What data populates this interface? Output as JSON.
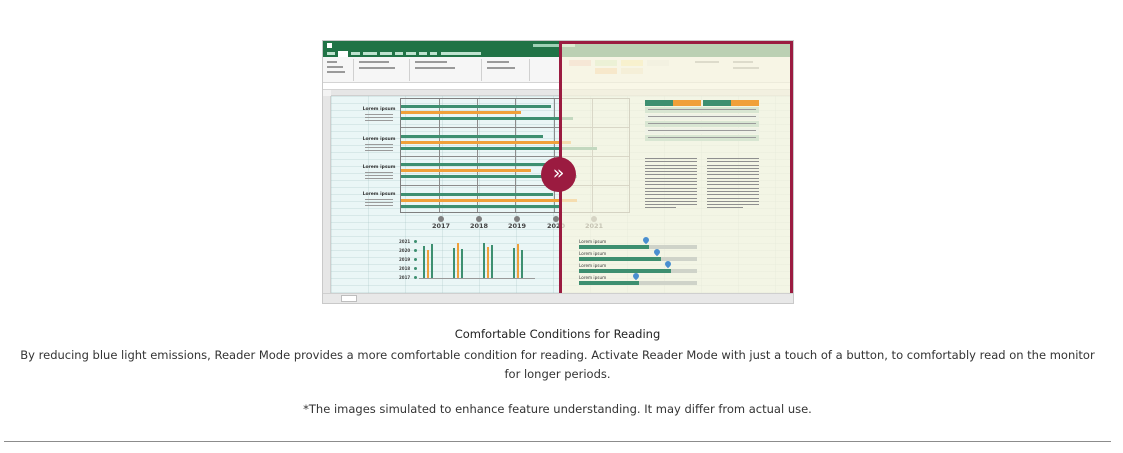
{
  "caption": {
    "title": "Comfortable Conditions for Reading",
    "description": "By reducing blue light emissions, Reader Mode provides a more comfortable condition for reading. Activate Reader Mode with just a touch of a button, to comfortably read on the monitor for longer periods.",
    "disclaimer": "*The images simulated to enhance feature understanding. It may differ from actual use."
  },
  "screenshot": {
    "year_labels": [
      "2017",
      "2018",
      "2019",
      "2020",
      "2021"
    ],
    "mini_years": [
      "2021",
      "2020",
      "2019",
      "2018",
      "2017"
    ],
    "label_block_heading": "Lorem ipsum",
    "progress_label": "Lorem ipsum",
    "toggle_icon": "double-chevron-right-icon",
    "toggle_glyph": "»",
    "colors": {
      "excel_green": "#217346",
      "bar_green": "#3d8f70",
      "bar_orange": "#f0a03a",
      "reader_border": "#9b1b40",
      "grid_bg": "#eaf6f6",
      "reader_bg": "#f6f4de"
    }
  }
}
